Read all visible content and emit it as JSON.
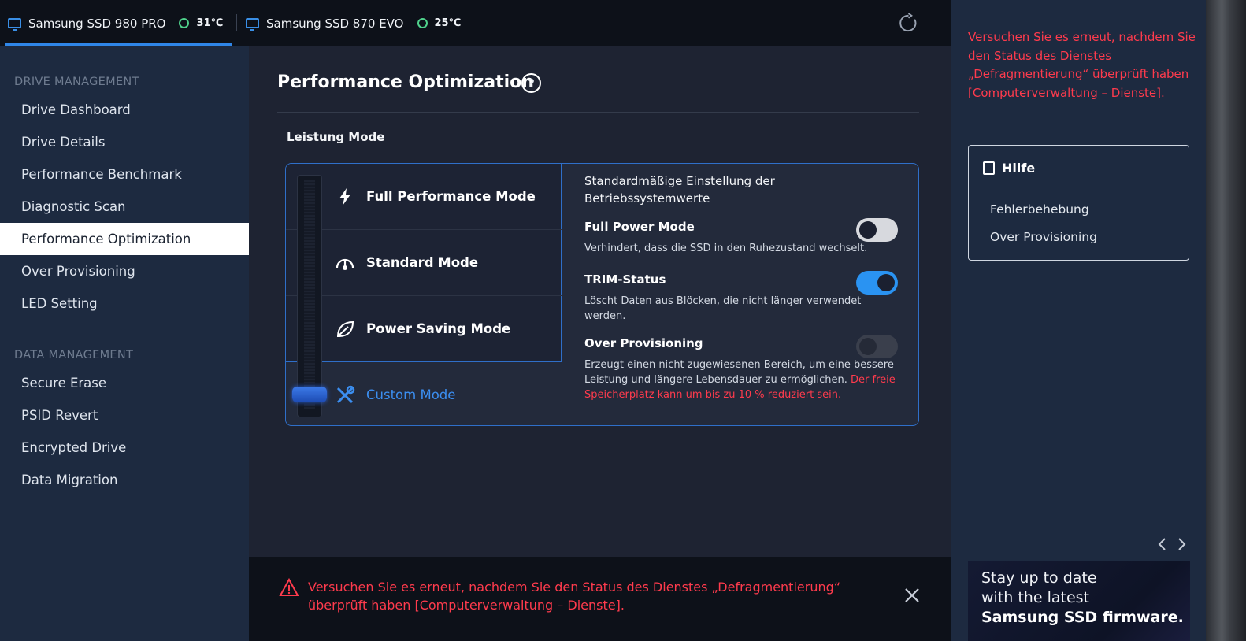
{
  "topbar": {
    "drives": [
      {
        "name": "Samsung SSD 980 PRO",
        "temp": "31℃"
      },
      {
        "name": "Samsung SSD 870 EVO",
        "temp": "25℃"
      }
    ]
  },
  "sidebar": {
    "drive_management_heading": "DRIVE MANAGEMENT",
    "drive_items": [
      {
        "label": "Drive Dashboard"
      },
      {
        "label": "Drive Details"
      },
      {
        "label": "Performance Benchmark"
      },
      {
        "label": "Diagnostic Scan"
      },
      {
        "label": "Performance Optimization"
      },
      {
        "label": "Over Provisioning"
      },
      {
        "label": "LED Setting"
      }
    ],
    "data_management_heading": "DATA MANAGEMENT",
    "data_items": [
      {
        "label": "Secure Erase"
      },
      {
        "label": "PSID Revert"
      },
      {
        "label": "Encrypted Drive"
      },
      {
        "label": "Data Migration"
      }
    ]
  },
  "main": {
    "title": "Performance Optimization",
    "help_glyph": "?",
    "section_title": "Leistung Mode",
    "modes": [
      {
        "label": "Full Performance Mode",
        "icon": "lightning-icon"
      },
      {
        "label": "Standard Mode",
        "icon": "speedometer-icon"
      },
      {
        "label": "Power Saving Mode",
        "icon": "leaf-icon"
      },
      {
        "label": "Custom Mode",
        "icon": "wrench-screwdriver-icon"
      }
    ],
    "selected_mode": "Custom Mode",
    "description": "Standardmäßige Einstellung der Betriebssystemwerte",
    "options": [
      {
        "title": "Full Power Mode",
        "desc": "Verhindert, dass die SSD in den Ruhezustand wechselt.",
        "state": "off"
      },
      {
        "title": "TRIM-Status",
        "desc": "Löscht Daten aus Blöcken, die nicht länger verwendet werden.",
        "state": "on"
      },
      {
        "title": "Over Provisioning",
        "desc": "Erzeugt einen nicht zugewiesenen Bereich, um eine bessere Leistung und längere Lebensdauer zu ermöglichen.",
        "warning": "Der freie Speicherplatz kann um bis zu 10 % reduziert sein.",
        "state": "disabled"
      }
    ]
  },
  "error_bar": {
    "message": "Versuchen Sie es erneut, nachdem Sie den Status des Dienstes „Defragmentierung“ überprüft haben [Computerverwaltung – Dienste]."
  },
  "right_panel": {
    "error_message": "Versuchen Sie es erneut, nachdem Sie den Status des Dienstes „Defragmentierung“ überprüft haben [Computerverwaltung – Dienste].",
    "help_title": "Hilfe",
    "help_links": [
      {
        "label": "Fehlerbehebung"
      },
      {
        "label": "Over Provisioning"
      }
    ],
    "banner_line1": "Stay up to date",
    "banner_line2": "with the latest",
    "banner_line3": "Samsung SSD firmware."
  },
  "colors": {
    "accent": "#2f86e8",
    "error": "#ff3b4d",
    "temp_ok": "#4fd18b"
  }
}
